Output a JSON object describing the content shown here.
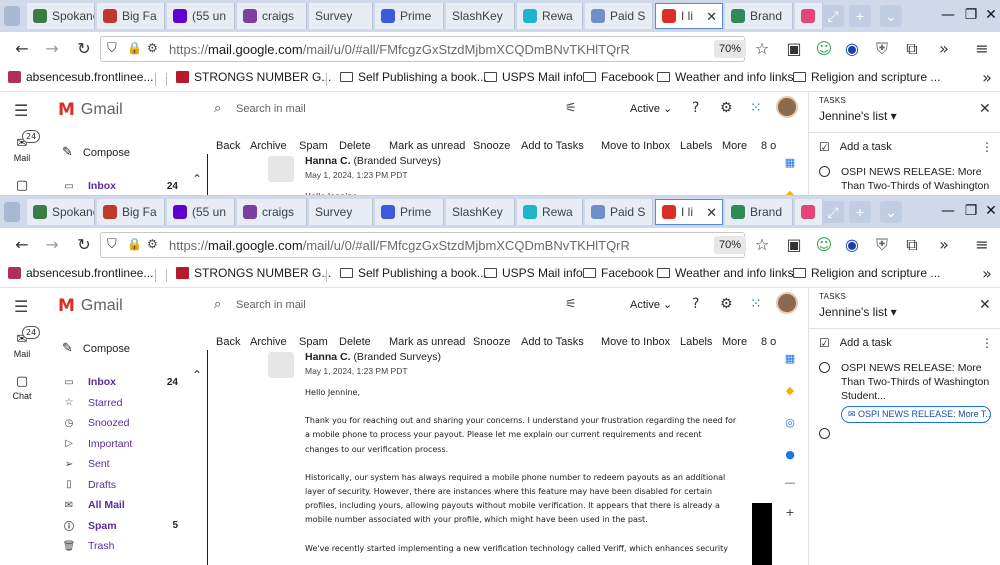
{
  "browser": {
    "tabs": [
      {
        "title": "Spokane",
        "icon": "spokeo-icon",
        "color": "#3a7d44"
      },
      {
        "title": "Big Fa",
        "icon": "bigfa-icon",
        "color": "#c0392b"
      },
      {
        "title": "(55 un",
        "icon": "yahoo-mail-icon",
        "color": "#6001d2"
      },
      {
        "title": "craigs",
        "icon": "peace-icon",
        "color": "#7b3fa0"
      },
      {
        "title": "Survey",
        "icon": "",
        "color": ""
      },
      {
        "title": "Prime",
        "icon": "prime-icon",
        "color": "#3b5bdb"
      },
      {
        "title": "SlashKey",
        "icon": "",
        "color": ""
      },
      {
        "title": "Rewa",
        "icon": "rewards-icon",
        "color": "#1fb5c8"
      },
      {
        "title": "Paid S",
        "icon": "globe-icon",
        "color": "#6f8fc9"
      },
      {
        "title": "I li",
        "icon": "gmail-icon",
        "color": "#d93025",
        "active": true
      },
      {
        "title": "Brand",
        "icon": "brand-icon",
        "color": "#2e8b57"
      },
      {
        "title": "",
        "icon": "yahoo-icon",
        "color": "#e5457a"
      }
    ],
    "tab_controls": [
      "⤢",
      "+",
      "⌄"
    ],
    "window_controls": [
      "—",
      "❐",
      "✕"
    ],
    "url": {
      "prefix": "https://",
      "host": "mail.google.com",
      "path": "/mail/u/0/#all/FMfcgzGxStzdMjbmXCQDmBNvTKHlTQrR"
    },
    "zoom": "70%",
    "bookmarks": [
      {
        "label": "absencesub.frontlinee...",
        "icon": "site"
      },
      {
        "label": "STRONGS NUMBER G...",
        "icon": "red"
      },
      {
        "label": "Self Publishing a book...",
        "icon": "folder"
      },
      {
        "label": "USPS Mail info",
        "icon": "folder"
      },
      {
        "label": "Facebook",
        "icon": "folder"
      },
      {
        "label": "Weather and info links",
        "icon": "folder"
      },
      {
        "label": "Religion and scripture ...",
        "icon": "folder"
      }
    ]
  },
  "gmail": {
    "brand": "Gmail",
    "search_placeholder": "Search in mail",
    "status": "Active",
    "toolbar": [
      "Back",
      "Archive",
      "Spam",
      "Delete",
      "Mark as unread",
      "Snooze",
      "Add to Tasks",
      "Move to Inbox",
      "Labels",
      "More",
      "8 o"
    ],
    "rail": {
      "mail": {
        "label": "Mail",
        "badge": "24"
      },
      "chat": {
        "label": "Chat"
      }
    },
    "compose": "Compose",
    "folders": [
      {
        "label": "Inbox",
        "count": "24",
        "bold": true,
        "icon": "▭"
      },
      {
        "label": "Starred",
        "count": "",
        "bold": false,
        "icon": "☆"
      },
      {
        "label": "Snoozed",
        "count": "",
        "bold": false,
        "icon": "◷"
      },
      {
        "label": "Important",
        "count": "",
        "bold": false,
        "icon": "▷"
      },
      {
        "label": "Sent",
        "count": "",
        "bold": false,
        "icon": "➢"
      },
      {
        "label": "Drafts",
        "count": "",
        "bold": false,
        "icon": "▯"
      },
      {
        "label": "All Mail",
        "count": "",
        "bold": true,
        "icon": "✉"
      },
      {
        "label": "Spam",
        "count": "5",
        "bold": true,
        "icon": "ⓘ"
      },
      {
        "label": "Trash",
        "count": "",
        "bold": false,
        "icon": "🗑"
      }
    ],
    "message": {
      "sender_name": "Hanna C.",
      "sender_org": "(Branded Surveys)",
      "date": "May 1, 2024, 1:23 PM PDT",
      "greeting": "Hello Jennine,",
      "paragraphs": [
        "Thank you for reaching out and sharing your concerns. I understand your frustration regarding the need for a mobile phone to process your payout. Please let me explain our current requirements and recent changes to our verification process.",
        "Historically, our system has always required a mobile phone number to redeem payouts as an additional layer of security. However, there are instances where this feature may have been disabled for certain profiles, including yours, allowing payouts without mobile verification. It appears that there is already a mobile number associated with your profile, which might have been used in the past.",
        "We've recently started implementing a new verification technology called Veriff, which enhances security"
      ]
    }
  },
  "tasks": {
    "kicker": "TASKS",
    "list_name": "Jennine's list",
    "add_task": "Add a task",
    "items": [
      {
        "title": "OSPI NEWS RELEASE: More Than Two-Thirds of Washington Student...",
        "chip": "OSPI NEWS RELEASE: More T..."
      },
      {
        "title": "",
        "chip": ""
      }
    ],
    "top_preview": "OSPI NEWS RELEASE:"
  },
  "colors": {
    "tabstrip": "#cfd9e9",
    "gmail_red": "#d93025",
    "link_purple": "#5b2c9e",
    "chip_blue": "#1a73e8"
  }
}
